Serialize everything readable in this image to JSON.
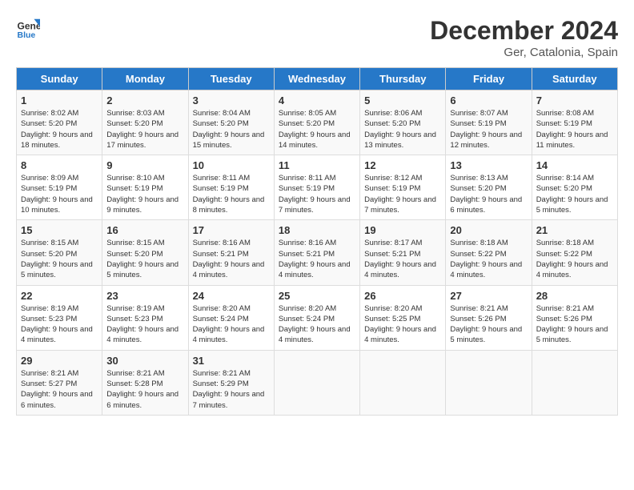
{
  "logo": {
    "line1": "General",
    "line2": "Blue"
  },
  "title": "December 2024",
  "location": "Ger, Catalonia, Spain",
  "days_of_week": [
    "Sunday",
    "Monday",
    "Tuesday",
    "Wednesday",
    "Thursday",
    "Friday",
    "Saturday"
  ],
  "weeks": [
    [
      {
        "day": 1,
        "sunrise": "8:02 AM",
        "sunset": "5:20 PM",
        "daylight": "9 hours and 18 minutes."
      },
      {
        "day": 2,
        "sunrise": "8:03 AM",
        "sunset": "5:20 PM",
        "daylight": "9 hours and 17 minutes."
      },
      {
        "day": 3,
        "sunrise": "8:04 AM",
        "sunset": "5:20 PM",
        "daylight": "9 hours and 15 minutes."
      },
      {
        "day": 4,
        "sunrise": "8:05 AM",
        "sunset": "5:20 PM",
        "daylight": "9 hours and 14 minutes."
      },
      {
        "day": 5,
        "sunrise": "8:06 AM",
        "sunset": "5:20 PM",
        "daylight": "9 hours and 13 minutes."
      },
      {
        "day": 6,
        "sunrise": "8:07 AM",
        "sunset": "5:19 PM",
        "daylight": "9 hours and 12 minutes."
      },
      {
        "day": 7,
        "sunrise": "8:08 AM",
        "sunset": "5:19 PM",
        "daylight": "9 hours and 11 minutes."
      }
    ],
    [
      {
        "day": 8,
        "sunrise": "8:09 AM",
        "sunset": "5:19 PM",
        "daylight": "9 hours and 10 minutes."
      },
      {
        "day": 9,
        "sunrise": "8:10 AM",
        "sunset": "5:19 PM",
        "daylight": "9 hours and 9 minutes."
      },
      {
        "day": 10,
        "sunrise": "8:11 AM",
        "sunset": "5:19 PM",
        "daylight": "9 hours and 8 minutes."
      },
      {
        "day": 11,
        "sunrise": "8:11 AM",
        "sunset": "5:19 PM",
        "daylight": "9 hours and 7 minutes."
      },
      {
        "day": 12,
        "sunrise": "8:12 AM",
        "sunset": "5:19 PM",
        "daylight": "9 hours and 7 minutes."
      },
      {
        "day": 13,
        "sunrise": "8:13 AM",
        "sunset": "5:20 PM",
        "daylight": "9 hours and 6 minutes."
      },
      {
        "day": 14,
        "sunrise": "8:14 AM",
        "sunset": "5:20 PM",
        "daylight": "9 hours and 5 minutes."
      }
    ],
    [
      {
        "day": 15,
        "sunrise": "8:15 AM",
        "sunset": "5:20 PM",
        "daylight": "9 hours and 5 minutes."
      },
      {
        "day": 16,
        "sunrise": "8:15 AM",
        "sunset": "5:20 PM",
        "daylight": "9 hours and 5 minutes."
      },
      {
        "day": 17,
        "sunrise": "8:16 AM",
        "sunset": "5:21 PM",
        "daylight": "9 hours and 4 minutes."
      },
      {
        "day": 18,
        "sunrise": "8:16 AM",
        "sunset": "5:21 PM",
        "daylight": "9 hours and 4 minutes."
      },
      {
        "day": 19,
        "sunrise": "8:17 AM",
        "sunset": "5:21 PM",
        "daylight": "9 hours and 4 minutes."
      },
      {
        "day": 20,
        "sunrise": "8:18 AM",
        "sunset": "5:22 PM",
        "daylight": "9 hours and 4 minutes."
      },
      {
        "day": 21,
        "sunrise": "8:18 AM",
        "sunset": "5:22 PM",
        "daylight": "9 hours and 4 minutes."
      }
    ],
    [
      {
        "day": 22,
        "sunrise": "8:19 AM",
        "sunset": "5:23 PM",
        "daylight": "9 hours and 4 minutes."
      },
      {
        "day": 23,
        "sunrise": "8:19 AM",
        "sunset": "5:23 PM",
        "daylight": "9 hours and 4 minutes."
      },
      {
        "day": 24,
        "sunrise": "8:20 AM",
        "sunset": "5:24 PM",
        "daylight": "9 hours and 4 minutes."
      },
      {
        "day": 25,
        "sunrise": "8:20 AM",
        "sunset": "5:24 PM",
        "daylight": "9 hours and 4 minutes."
      },
      {
        "day": 26,
        "sunrise": "8:20 AM",
        "sunset": "5:25 PM",
        "daylight": "9 hours and 4 minutes."
      },
      {
        "day": 27,
        "sunrise": "8:21 AM",
        "sunset": "5:26 PM",
        "daylight": "9 hours and 5 minutes."
      },
      {
        "day": 28,
        "sunrise": "8:21 AM",
        "sunset": "5:26 PM",
        "daylight": "9 hours and 5 minutes."
      }
    ],
    [
      {
        "day": 29,
        "sunrise": "8:21 AM",
        "sunset": "5:27 PM",
        "daylight": "9 hours and 6 minutes."
      },
      {
        "day": 30,
        "sunrise": "8:21 AM",
        "sunset": "5:28 PM",
        "daylight": "9 hours and 6 minutes."
      },
      {
        "day": 31,
        "sunrise": "8:21 AM",
        "sunset": "5:29 PM",
        "daylight": "9 hours and 7 minutes."
      },
      null,
      null,
      null,
      null
    ]
  ]
}
